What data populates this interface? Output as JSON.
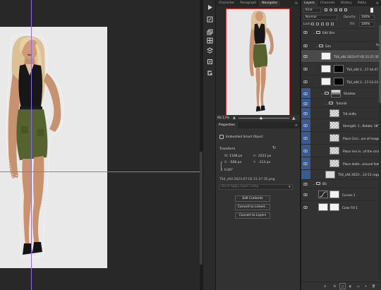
{
  "middle_tabs": {
    "character": "Character",
    "paragraph": "Paragraph",
    "navigator": "Navigator",
    "menu": "≡"
  },
  "navigator": {
    "zoom": "66.13%"
  },
  "properties": {
    "tab": "Properties",
    "object_type": "Embedded Smart Object",
    "section": "Transform",
    "w_label": "W:",
    "w_value": "1168 px",
    "h_label": "H:",
    "h_value": "2223 px",
    "x_label": "X:",
    "x_value": "-508 px",
    "y_label": "Y:",
    "y_value": "-113 px",
    "angle_value": "0.00°",
    "file_name": "TS4_x64 2023-07-02 21-27-35.png",
    "comp_placeholder": "Don't Apply Layer Comp",
    "btn_edit": "Edit Contents",
    "btn_linked": "Convert to Linked...",
    "btn_layers": "Convert to Layers"
  },
  "layers_tabs": {
    "layers": "Layers",
    "channels": "Channels",
    "history": "History",
    "paths": "Paths"
  },
  "layers_panel": {
    "search_value": "Kind",
    "blend_mode": "Normal",
    "opacity_label": "Opacity:",
    "opacity_value": "100%",
    "lock_label": "Lock:",
    "fill_label": "Fill:",
    "fill_value": "100%",
    "layers": [
      {
        "name": "Edit Sim"
      },
      {
        "name": "Sim",
        "fx": "fx"
      },
      {
        "name": "TS4_x64 2023-07-02 21-27-35"
      },
      {
        "name": "TS4_x64 2...17-14-47"
      },
      {
        "name": "TS4_x64 2...17-13-13"
      },
      {
        "name": "Shadow"
      },
      {
        "name": "Tutorial"
      },
      {
        "name": "Tilt shifts"
      },
      {
        "name": "Strength: 1...Rotate: 18°"
      },
      {
        "name": "Place Circl...ure of image"
      },
      {
        "name": "Place line in...of the circle"
      },
      {
        "name": "Place dotte...around feet"
      },
      {
        "name": "TS4_x64 2023-...13-13 copy"
      },
      {
        "name": "BG"
      },
      {
        "name": "Curves 1"
      },
      {
        "name": "Color Fill 1"
      }
    ],
    "footer": {
      "link": "⊝",
      "fx": "fx",
      "mask": "◻",
      "adjust": "◐",
      "folder": "▭",
      "new": "+",
      "delete": "🗑"
    }
  },
  "colors": {
    "guide": "#8a6cf0",
    "selected_vis": "#3a5a92",
    "highlight": "#e23a3a",
    "skirt": "#55612f",
    "top": "#161616",
    "hair": "#e3ca9e",
    "skin": "#c8916c"
  }
}
